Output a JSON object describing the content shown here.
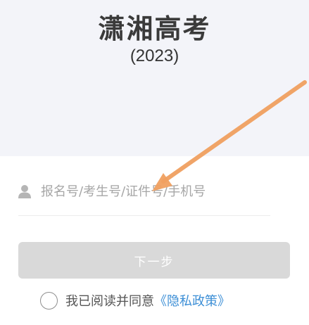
{
  "header": {
    "title": "潇湘高考",
    "year": "(2023)"
  },
  "form": {
    "id_field": {
      "value": "",
      "placeholder": "报名号/考生号/证件号/手机号"
    },
    "next_label": "下一步",
    "agreement": {
      "text": "我已阅读并同意",
      "link": "《隐私政策》"
    }
  },
  "annotation": {
    "arrow_color": "#f0a060"
  },
  "icons": [
    "user-icon"
  ]
}
